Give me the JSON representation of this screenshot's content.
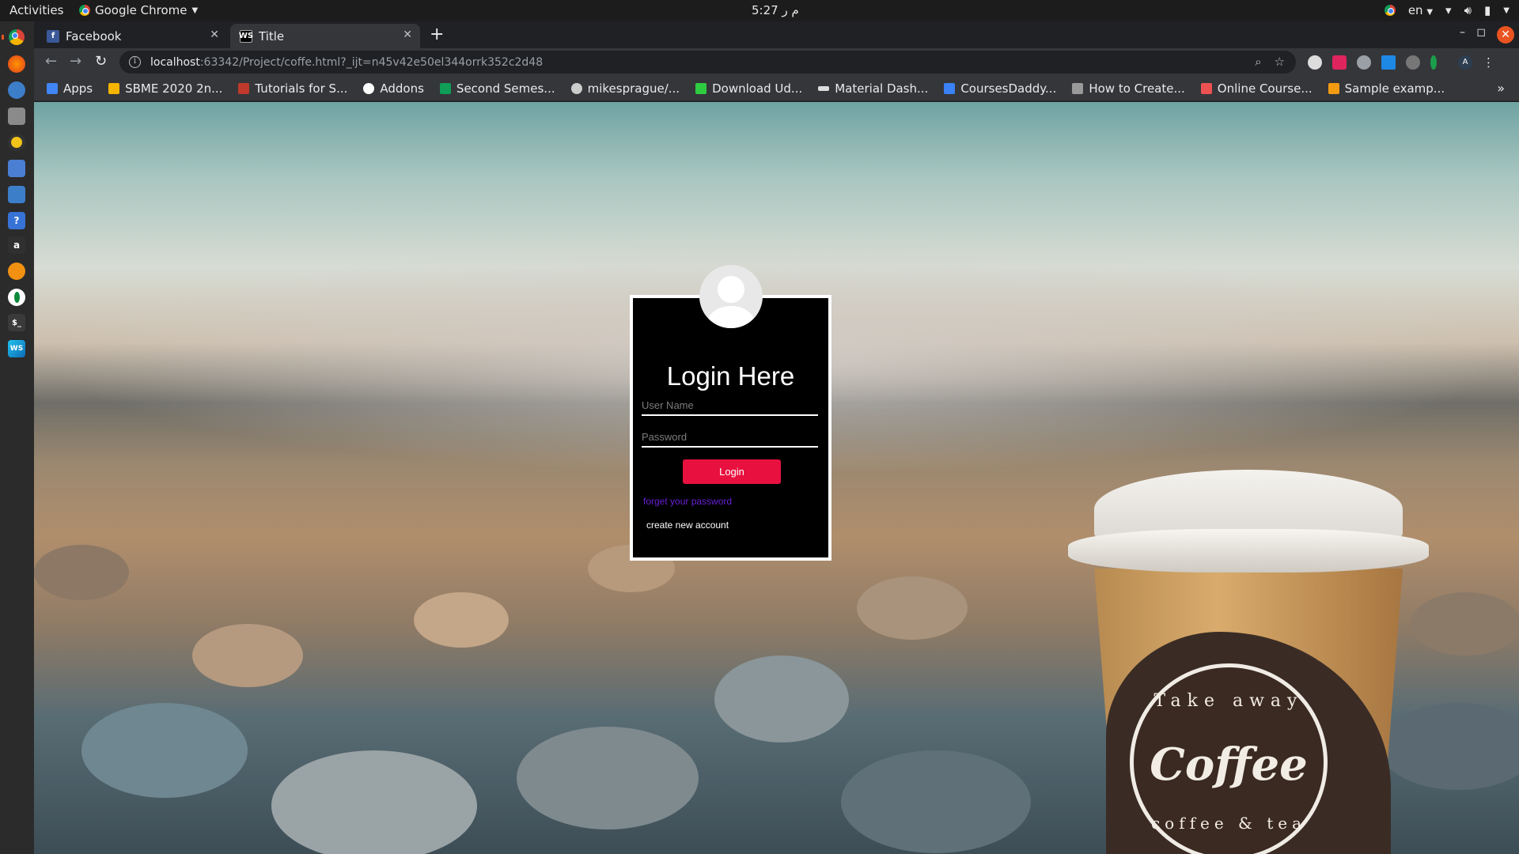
{
  "topbar": {
    "activities": "Activities",
    "app_name": "Google Chrome",
    "clock": "5:27 م ر",
    "lang": "en"
  },
  "tabs": [
    {
      "title": "Facebook",
      "icon": "facebook-icon",
      "active": false
    },
    {
      "title": "Title",
      "icon": "webstorm-icon",
      "active": true
    }
  ],
  "toolbar": {
    "url_host": "localhost",
    "url_rest": ":63342/Project/coffe.html?_ijt=n45v42e50el344orrk352c2d48"
  },
  "bookmarks": [
    {
      "label": "Apps",
      "icon": "apps-grid-icon",
      "color": "#4285f4"
    },
    {
      "label": "SBME 2020 2n...",
      "icon": "drive-icon",
      "color": "#f4b400"
    },
    {
      "label": "Tutorials for S...",
      "icon": "bookmark-icon",
      "color": "#c0392b"
    },
    {
      "label": "Addons",
      "icon": "globe-icon",
      "color": "#ffffff"
    },
    {
      "label": "Second Semes...",
      "icon": "drive-icon",
      "color": "#0f9d58"
    },
    {
      "label": "mikesprague/...",
      "icon": "github-icon",
      "color": "#cccccc"
    },
    {
      "label": "Download Ud...",
      "icon": "ftu-icon",
      "color": "#2ecc40"
    },
    {
      "label": "Material Dash...",
      "icon": "mask-icon",
      "color": "#dddddd"
    },
    {
      "label": "CoursesDaddy...",
      "icon": "t-icon",
      "color": "#3b82f6"
    },
    {
      "label": "How to Create...",
      "icon": "page-icon",
      "color": "#999999"
    },
    {
      "label": "Online Course...",
      "icon": "udemy-icon",
      "color": "#ec5252"
    },
    {
      "label": "Sample examp...",
      "icon": "person-icon",
      "color": "#f39c12"
    }
  ],
  "login": {
    "title": "Login Here",
    "username_placeholder": "User Name",
    "password_placeholder": "Password",
    "button_label": "Login",
    "forgot_link": "forget your password",
    "create_link": "create new account"
  },
  "cup_logo": {
    "line1": "Take away",
    "line2": "Coffee",
    "line3": "coffee & tea"
  },
  "colors": {
    "login_button": "#e8103f",
    "forgot_link": "#6a1fd8",
    "ubuntu_accent": "#e95420"
  }
}
